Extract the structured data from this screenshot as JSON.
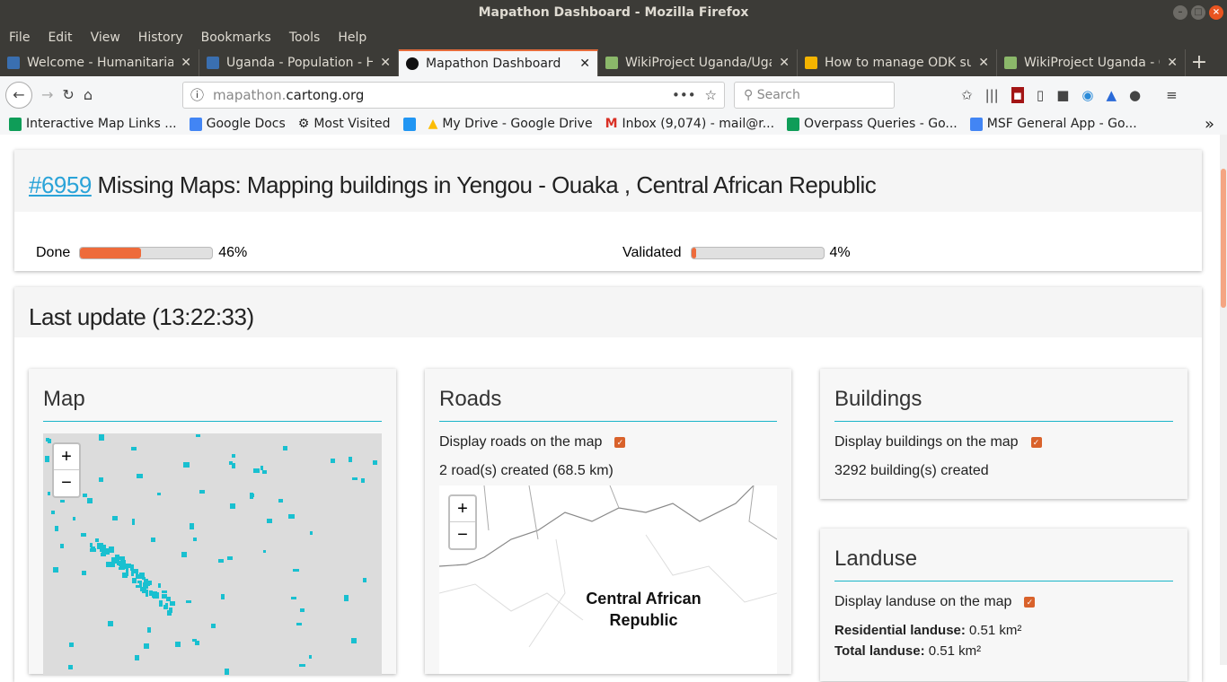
{
  "window": {
    "title": "Mapathon Dashboard - Mozilla Firefox"
  },
  "menu": [
    "File",
    "Edit",
    "View",
    "History",
    "Bookmarks",
    "Tools",
    "Help"
  ],
  "tabs": [
    {
      "label": "Welcome - Humanitarian",
      "color": "#3a6fb0"
    },
    {
      "label": "Uganda - Population - Hu",
      "color": "#3a6fb0"
    },
    {
      "label": "Mapathon Dashboard",
      "color": "#111"
    },
    {
      "label": "WikiProject Uganda/Uga",
      "color": "#8bb86a"
    },
    {
      "label": "How to manage ODK sur",
      "color": "#f4b400"
    },
    {
      "label": "WikiProject Uganda - Op",
      "color": "#8bb86a"
    }
  ],
  "url": {
    "host": "mapathon.",
    "domain": "cartong.org"
  },
  "search": {
    "placeholder": "Search"
  },
  "bookmarks": [
    {
      "label": "Interactive Map Links ...",
      "color": "#0f9d58"
    },
    {
      "label": "Google Docs",
      "color": "#4285f4"
    },
    {
      "label": "Most Visited",
      "color": "#666"
    },
    {
      "label": "",
      "color": "#2196f3"
    },
    {
      "label": "My Drive - Google Drive",
      "color": "#fbbc05"
    },
    {
      "label": "Inbox (9,074) - mail@r...",
      "color": "#d93025"
    },
    {
      "label": "Overpass Queries - Go...",
      "color": "#0f9d58"
    },
    {
      "label": "MSF General App - Go...",
      "color": "#4285f4"
    }
  ],
  "project": {
    "id": "#6959",
    "title": "Missing Maps: Mapping buildings in Yengou - Ouaka , Central African Republic",
    "done_label": "Done",
    "done": 46,
    "done_text": "46%",
    "validated_label": "Validated",
    "validated": 4,
    "validated_text": "4%"
  },
  "update": {
    "title": "Last update (13:22:33)"
  },
  "map": {
    "title": "Map",
    "zoom_in": "+",
    "zoom_out": "−"
  },
  "roads": {
    "title": "Roads",
    "display": "Display roads on the map",
    "count": "2 road(s) created (68.5 km)",
    "map_label": "Central African Republic"
  },
  "buildings": {
    "title": "Buildings",
    "display": "Display buildings on the map",
    "count": "3292 building(s) created"
  },
  "landuse": {
    "title": "Landuse",
    "display": "Display landuse on the map",
    "residential_label": "Residential landuse:",
    "residential_value": "0.51 km²",
    "total_label": "Total landuse:",
    "total_value": "0.51 km²"
  }
}
